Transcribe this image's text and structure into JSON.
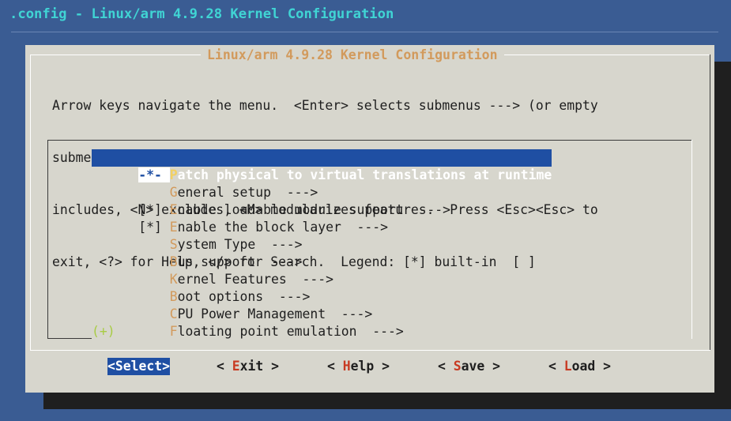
{
  "window": {
    "title": ".config - Linux/arm 4.9.28 Kernel Configuration"
  },
  "dialog": {
    "title": "Linux/arm 4.9.28 Kernel Configuration",
    "help_lines": [
      "Arrow keys navigate the menu.  <Enter> selects submenus ---> (or empty",
      "submenus ----).  Highlighted letters are hotkeys.  Pressing <Y>",
      "includes, <N> excludes, <M> modularizes features.  Press <Esc><Esc> to",
      "exit, <?> for Help, </> for Search.  Legend: [*] built-in  [ ]"
    ]
  },
  "menu": {
    "items": [
      {
        "prefix": "-*- ",
        "hotkey": "P",
        "rest": "atch physical to virtual translations at runtime",
        "selected": true
      },
      {
        "prefix": "    ",
        "hotkey": "G",
        "rest": "eneral setup  --->",
        "selected": false
      },
      {
        "prefix": "[*] ",
        "hotkey": "E",
        "rest": "nable loadable module support  --->",
        "selected": false
      },
      {
        "prefix": "[*] ",
        "hotkey": "E",
        "rest": "nable the block layer  --->",
        "selected": false
      },
      {
        "prefix": "    ",
        "hotkey": "S",
        "rest": "ystem Type  --->",
        "selected": false
      },
      {
        "prefix": "    ",
        "hotkey": "B",
        "rest": "us support  --->",
        "selected": false
      },
      {
        "prefix": "    ",
        "hotkey": "K",
        "rest": "ernel Features  --->",
        "selected": false
      },
      {
        "prefix": "    ",
        "hotkey": "B",
        "rest": "oot options  --->",
        "selected": false
      },
      {
        "prefix": "    ",
        "hotkey": "C",
        "rest": "PU Power Management  --->",
        "selected": false
      },
      {
        "prefix": "    ",
        "hotkey": "F",
        "rest": "loating point emulation  --->",
        "selected": false
      }
    ],
    "more_indicator": "(+)"
  },
  "buttons": [
    {
      "left": "<",
      "hotkey": "S",
      "rest": "elect",
      "right": ">",
      "active": true
    },
    {
      "left": "< ",
      "hotkey": "E",
      "rest": "xit",
      "right": " >",
      "active": false
    },
    {
      "left": "< ",
      "hotkey": "H",
      "rest": "elp",
      "right": " >",
      "active": false
    },
    {
      "left": "< ",
      "hotkey": "S",
      "rest": "ave",
      "right": " >",
      "active": false
    },
    {
      "left": "< ",
      "hotkey": "L",
      "rest": "oad",
      "right": " >",
      "active": false
    }
  ],
  "colors": {
    "background": "#3a5c93",
    "dialog": "#d7d6cd",
    "selection": "#1f4fa3",
    "title_text": "#40d4d4",
    "hotkey": "#d29a5c",
    "button_hotkey": "#c83a22",
    "more_indicator": "#a8cc44"
  }
}
